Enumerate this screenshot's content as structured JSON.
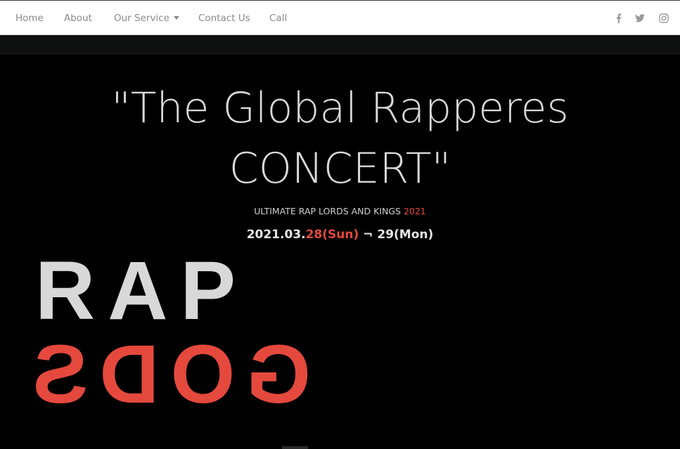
{
  "nav": {
    "items": [
      {
        "label": "Home"
      },
      {
        "label": "About"
      },
      {
        "label": "Our Service"
      },
      {
        "label": "Contact Us"
      },
      {
        "label": "Call"
      }
    ],
    "social": [
      "facebook-icon",
      "twitter-icon",
      "instagram-icon"
    ]
  },
  "hero": {
    "title_line1": "\"The Global Rapperes",
    "title_line2": "CONCERT\"",
    "subtitle_main": "ULTIMATE RAP LORDS AND KINGS ",
    "subtitle_year": "2021",
    "date_start": "2021.03.",
    "date_start_day": "28(Sun)",
    "date_separator": " ¬ ",
    "date_end": "29(Mon)"
  },
  "logo": {
    "word1": "RAP",
    "word2": "GODS"
  },
  "colors": {
    "accent": "#e5493d",
    "background": "#000000",
    "nav_bg": "#ffffff",
    "nav_text": "#8a8a8a"
  }
}
